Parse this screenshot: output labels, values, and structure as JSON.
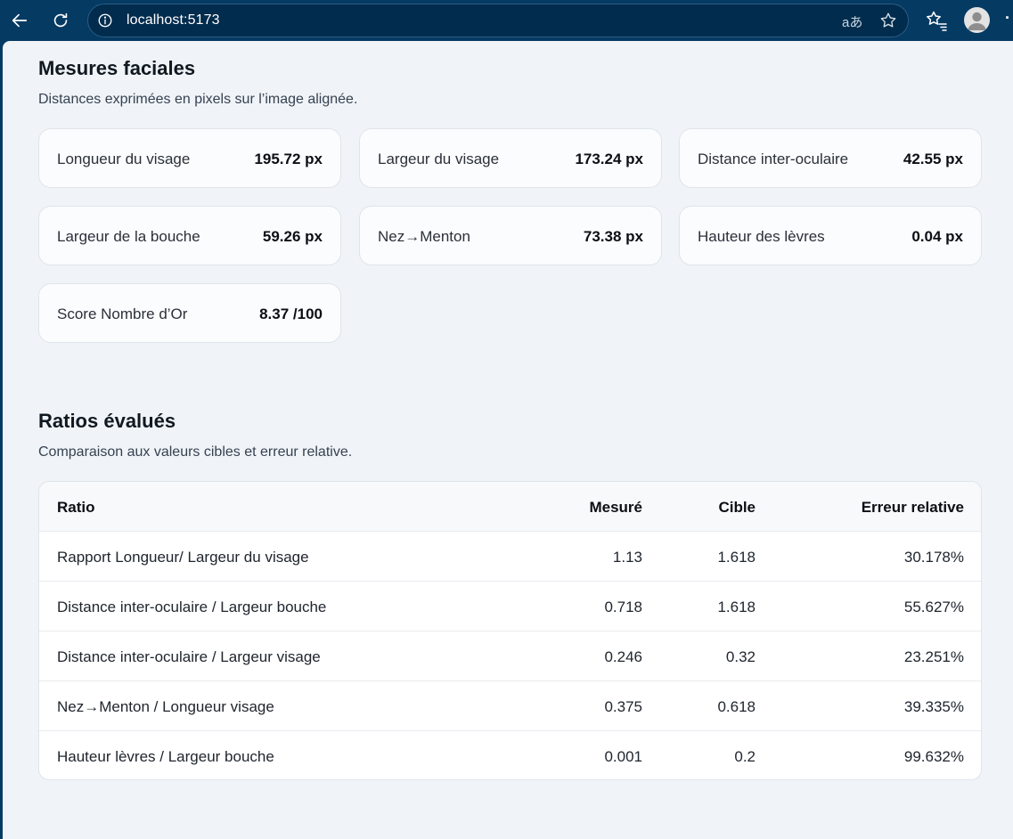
{
  "browser": {
    "url": "localhost:5173",
    "read_aloud_label": "aあ"
  },
  "mesures": {
    "title": "Mesures faciales",
    "subtitle": "Distances exprimées en pixels sur l’image alignée.",
    "cards": [
      {
        "label": "Longueur du visage",
        "value": "195.72 px"
      },
      {
        "label": "Largeur du visage",
        "value": "173.24 px"
      },
      {
        "label": "Distance inter-oculaire",
        "value": "42.55 px"
      },
      {
        "label": "Largeur de la bouche",
        "value": "59.26 px"
      },
      {
        "label": "Nez→Menton",
        "value": "73.38 px"
      },
      {
        "label": "Hauteur des lèvres",
        "value": "0.04 px"
      },
      {
        "label": "Score Nombre d’Or",
        "value": "8.37 /100"
      }
    ]
  },
  "ratios": {
    "title": "Ratios évalués",
    "subtitle": "Comparaison aux valeurs cibles et erreur relative.",
    "headers": {
      "ratio": "Ratio",
      "mesure": "Mesuré",
      "cible": "Cible",
      "erreur": "Erreur relative"
    },
    "rows": [
      {
        "ratio": "Rapport Longueur/ Largeur du visage",
        "mesure": "1.13",
        "cible": "1.618",
        "erreur": "30.178%"
      },
      {
        "ratio": "Distance inter-oculaire / Largeur bouche",
        "mesure": "0.718",
        "cible": "1.618",
        "erreur": "55.627%"
      },
      {
        "ratio": "Distance inter-oculaire / Largeur visage",
        "mesure": "0.246",
        "cible": "0.32",
        "erreur": "23.251%"
      },
      {
        "ratio": "Nez→Menton / Longueur visage",
        "mesure": "0.375",
        "cible": "0.618",
        "erreur": "39.335%"
      },
      {
        "ratio": "Hauteur lèvres / Largeur bouche",
        "mesure": "0.001",
        "cible": "0.2",
        "erreur": "99.632%"
      }
    ]
  }
}
